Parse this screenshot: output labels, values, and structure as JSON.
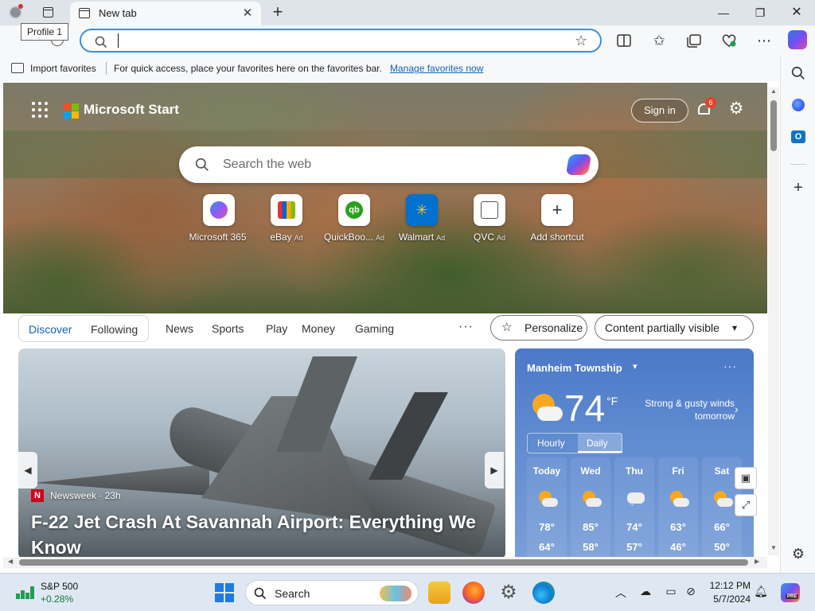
{
  "window": {
    "tab_title": "New tab",
    "profile_tooltip": "Profile 1",
    "minimize": "—",
    "maximize": "❐",
    "close": "✕",
    "new_tab": "+",
    "tab_close": "✕"
  },
  "address_bar": {
    "value": "",
    "placeholder": ""
  },
  "favorites_bar": {
    "import_label": "Import favorites",
    "hint": "For quick access, place your favorites here on the favorites bar.",
    "manage_link": "Manage favorites now"
  },
  "toolbar_icons": [
    "refresh-icon",
    "split-screen-icon",
    "favorites-icon",
    "collections-icon",
    "browser-essentials-icon",
    "more-icon",
    "copilot-icon"
  ],
  "sidebar_icons": [
    "search-icon",
    "copilot-app-icon",
    "outlook-icon",
    "add-icon",
    "settings-icon"
  ],
  "page": {
    "brand": "Microsoft Start",
    "sign_in": "Sign in",
    "notification_count": "6",
    "search_placeholder": "Search the web",
    "shortcuts": [
      {
        "label": "Microsoft 365",
        "ad": "",
        "color": "#7b55e6"
      },
      {
        "label": "eBay",
        "ad": "Ad",
        "color": "#e53238"
      },
      {
        "label": "QuickBoo...",
        "ad": "Ad",
        "color": "#2ca01c"
      },
      {
        "label": "Walmart",
        "ad": "Ad",
        "color": "#0071ce"
      },
      {
        "label": "QVC",
        "ad": "Ad",
        "color": "#555555"
      },
      {
        "label": "Add shortcut",
        "ad": "",
        "color": "#333333"
      }
    ],
    "feed_tabs": {
      "discover": "Discover",
      "following": "Following",
      "links": [
        "News",
        "Sports",
        "Play",
        "Money",
        "Gaming"
      ],
      "more": "···",
      "personalize": "Personalize",
      "visibility": "Content partially visible"
    },
    "news_card": {
      "source": "Newsweek · 23h",
      "source_logo": "N",
      "headline": "F-22 Jet Crash At Savannah Airport: Everything We Know"
    },
    "weather": {
      "location": "Manheim Township",
      "temperature": "74",
      "unit": "°F",
      "alert": "Strong & gusty winds tomorrow",
      "tab_hourly": "Hourly",
      "tab_daily": "Daily",
      "days": [
        {
          "name": "Today",
          "high": "78°",
          "low": "64°",
          "icon": "partly-sunny-icon"
        },
        {
          "name": "Wed",
          "high": "85°",
          "low": "58°",
          "icon": "partly-sunny-icon"
        },
        {
          "name": "Thu",
          "high": "74°",
          "low": "57°",
          "icon": "rain-showers-icon"
        },
        {
          "name": "Fri",
          "high": "63°",
          "low": "46°",
          "icon": "partly-sunny-icon"
        },
        {
          "name": "Sat",
          "high": "66°",
          "low": "50°",
          "icon": "partly-sunny-icon"
        }
      ]
    }
  },
  "taskbar": {
    "stock_name": "S&P 500",
    "stock_change": "+0.28%",
    "search_label": "Search",
    "time": "12:12 PM",
    "date": "5/7/2024",
    "copilot_badge": "PRE"
  }
}
